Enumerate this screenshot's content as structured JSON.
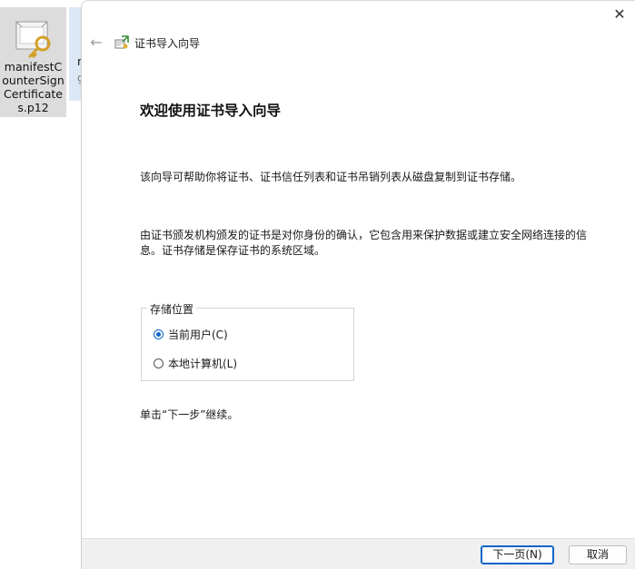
{
  "desktop": {
    "file1_name": "manifestCounterSignCertificates.p12",
    "file2_partial_line1": "n",
    "file2_partial_line2": "g"
  },
  "dialog": {
    "wizard_title": "证书导入向导",
    "welcome_title": "欢迎使用证书导入向导",
    "description1": "该向导可帮助你将证书、证书信任列表和证书吊销列表从磁盘复制到证书存储。",
    "description2": "由证书颁发机构颁发的证书是对你身份的确认，它包含用来保护数据或建立安全网络连接的信息。证书存储是保存证书的系统区域。",
    "store_location": {
      "legend": "存储位置",
      "options": [
        {
          "label": "当前用户(C)",
          "selected": true
        },
        {
          "label": "本地计算机(L)",
          "selected": false
        }
      ]
    },
    "continue_text": "单击“下一步”继续。",
    "buttons": {
      "next": "下一页(N)",
      "cancel": "取消"
    },
    "icons": {
      "close": "close-icon",
      "back": "back-arrow-icon",
      "wizard": "certificate-wizard-icon"
    },
    "accent_color": "#0a64c8"
  }
}
